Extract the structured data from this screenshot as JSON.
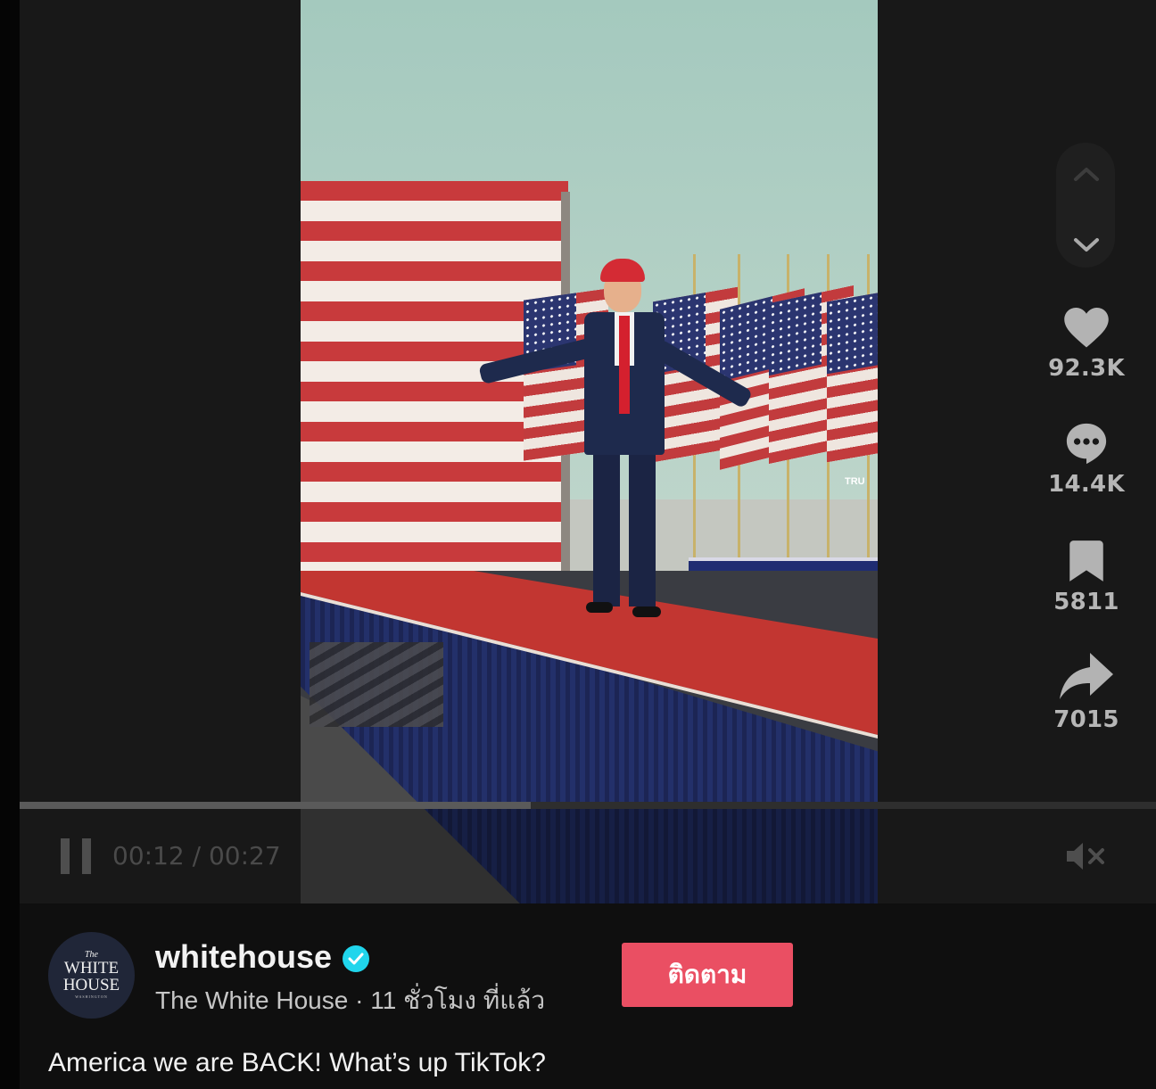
{
  "video": {
    "likes": "92.3K",
    "comments": "14.4K",
    "saves": "5811",
    "shares": "7015",
    "time_current": "00:12",
    "time_sep": " / ",
    "time_total": "00:27",
    "progress": 0.45,
    "muted": true,
    "sign_text": "TRU"
  },
  "nav": {
    "up_icon": "chevron-up-icon",
    "down_icon": "chevron-down-icon"
  },
  "author": {
    "avatar_the": "The",
    "avatar_line1": "WHITE",
    "avatar_line2": "HOUSE",
    "avatar_line3": "WASHINGTON",
    "username": "whitehouse",
    "display_name": "The White House",
    "separator": " · ",
    "posted": "11 ชั่วโมง ที่แล้ว",
    "verified": true
  },
  "follow_label": "ติดตาม",
  "caption": "America we are BACK! What’s up TikTok?",
  "colors": {
    "accent": "#ea4f63",
    "verified": "#20d5ec",
    "background": "#0f0f0f"
  }
}
